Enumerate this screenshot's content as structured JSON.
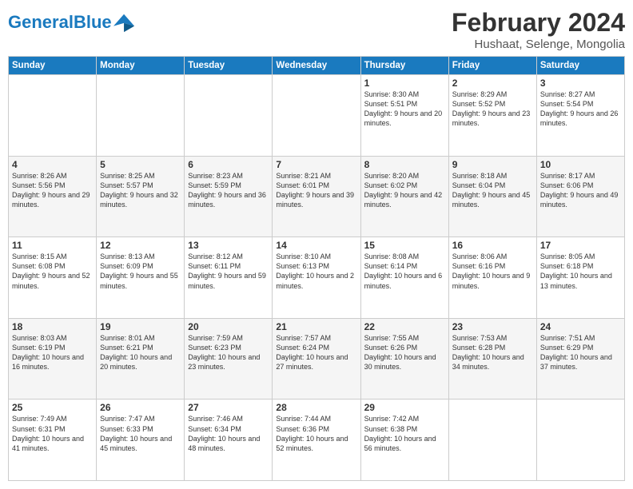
{
  "header": {
    "logo_general": "General",
    "logo_blue": "Blue",
    "month_title": "February 2024",
    "location": "Hushaat, Selenge, Mongolia"
  },
  "days_of_week": [
    "Sunday",
    "Monday",
    "Tuesday",
    "Wednesday",
    "Thursday",
    "Friday",
    "Saturday"
  ],
  "weeks": [
    [
      {
        "day": "",
        "info": ""
      },
      {
        "day": "",
        "info": ""
      },
      {
        "day": "",
        "info": ""
      },
      {
        "day": "",
        "info": ""
      },
      {
        "day": "1",
        "info": "Sunrise: 8:30 AM\nSunset: 5:51 PM\nDaylight: 9 hours and 20 minutes."
      },
      {
        "day": "2",
        "info": "Sunrise: 8:29 AM\nSunset: 5:52 PM\nDaylight: 9 hours and 23 minutes."
      },
      {
        "day": "3",
        "info": "Sunrise: 8:27 AM\nSunset: 5:54 PM\nDaylight: 9 hours and 26 minutes."
      }
    ],
    [
      {
        "day": "4",
        "info": "Sunrise: 8:26 AM\nSunset: 5:56 PM\nDaylight: 9 hours and 29 minutes."
      },
      {
        "day": "5",
        "info": "Sunrise: 8:25 AM\nSunset: 5:57 PM\nDaylight: 9 hours and 32 minutes."
      },
      {
        "day": "6",
        "info": "Sunrise: 8:23 AM\nSunset: 5:59 PM\nDaylight: 9 hours and 36 minutes."
      },
      {
        "day": "7",
        "info": "Sunrise: 8:21 AM\nSunset: 6:01 PM\nDaylight: 9 hours and 39 minutes."
      },
      {
        "day": "8",
        "info": "Sunrise: 8:20 AM\nSunset: 6:02 PM\nDaylight: 9 hours and 42 minutes."
      },
      {
        "day": "9",
        "info": "Sunrise: 8:18 AM\nSunset: 6:04 PM\nDaylight: 9 hours and 45 minutes."
      },
      {
        "day": "10",
        "info": "Sunrise: 8:17 AM\nSunset: 6:06 PM\nDaylight: 9 hours and 49 minutes."
      }
    ],
    [
      {
        "day": "11",
        "info": "Sunrise: 8:15 AM\nSunset: 6:08 PM\nDaylight: 9 hours and 52 minutes."
      },
      {
        "day": "12",
        "info": "Sunrise: 8:13 AM\nSunset: 6:09 PM\nDaylight: 9 hours and 55 minutes."
      },
      {
        "day": "13",
        "info": "Sunrise: 8:12 AM\nSunset: 6:11 PM\nDaylight: 9 hours and 59 minutes."
      },
      {
        "day": "14",
        "info": "Sunrise: 8:10 AM\nSunset: 6:13 PM\nDaylight: 10 hours and 2 minutes."
      },
      {
        "day": "15",
        "info": "Sunrise: 8:08 AM\nSunset: 6:14 PM\nDaylight: 10 hours and 6 minutes."
      },
      {
        "day": "16",
        "info": "Sunrise: 8:06 AM\nSunset: 6:16 PM\nDaylight: 10 hours and 9 minutes."
      },
      {
        "day": "17",
        "info": "Sunrise: 8:05 AM\nSunset: 6:18 PM\nDaylight: 10 hours and 13 minutes."
      }
    ],
    [
      {
        "day": "18",
        "info": "Sunrise: 8:03 AM\nSunset: 6:19 PM\nDaylight: 10 hours and 16 minutes."
      },
      {
        "day": "19",
        "info": "Sunrise: 8:01 AM\nSunset: 6:21 PM\nDaylight: 10 hours and 20 minutes."
      },
      {
        "day": "20",
        "info": "Sunrise: 7:59 AM\nSunset: 6:23 PM\nDaylight: 10 hours and 23 minutes."
      },
      {
        "day": "21",
        "info": "Sunrise: 7:57 AM\nSunset: 6:24 PM\nDaylight: 10 hours and 27 minutes."
      },
      {
        "day": "22",
        "info": "Sunrise: 7:55 AM\nSunset: 6:26 PM\nDaylight: 10 hours and 30 minutes."
      },
      {
        "day": "23",
        "info": "Sunrise: 7:53 AM\nSunset: 6:28 PM\nDaylight: 10 hours and 34 minutes."
      },
      {
        "day": "24",
        "info": "Sunrise: 7:51 AM\nSunset: 6:29 PM\nDaylight: 10 hours and 37 minutes."
      }
    ],
    [
      {
        "day": "25",
        "info": "Sunrise: 7:49 AM\nSunset: 6:31 PM\nDaylight: 10 hours and 41 minutes."
      },
      {
        "day": "26",
        "info": "Sunrise: 7:47 AM\nSunset: 6:33 PM\nDaylight: 10 hours and 45 minutes."
      },
      {
        "day": "27",
        "info": "Sunrise: 7:46 AM\nSunset: 6:34 PM\nDaylight: 10 hours and 48 minutes."
      },
      {
        "day": "28",
        "info": "Sunrise: 7:44 AM\nSunset: 6:36 PM\nDaylight: 10 hours and 52 minutes."
      },
      {
        "day": "29",
        "info": "Sunrise: 7:42 AM\nSunset: 6:38 PM\nDaylight: 10 hours and 56 minutes."
      },
      {
        "day": "",
        "info": ""
      },
      {
        "day": "",
        "info": ""
      }
    ]
  ]
}
